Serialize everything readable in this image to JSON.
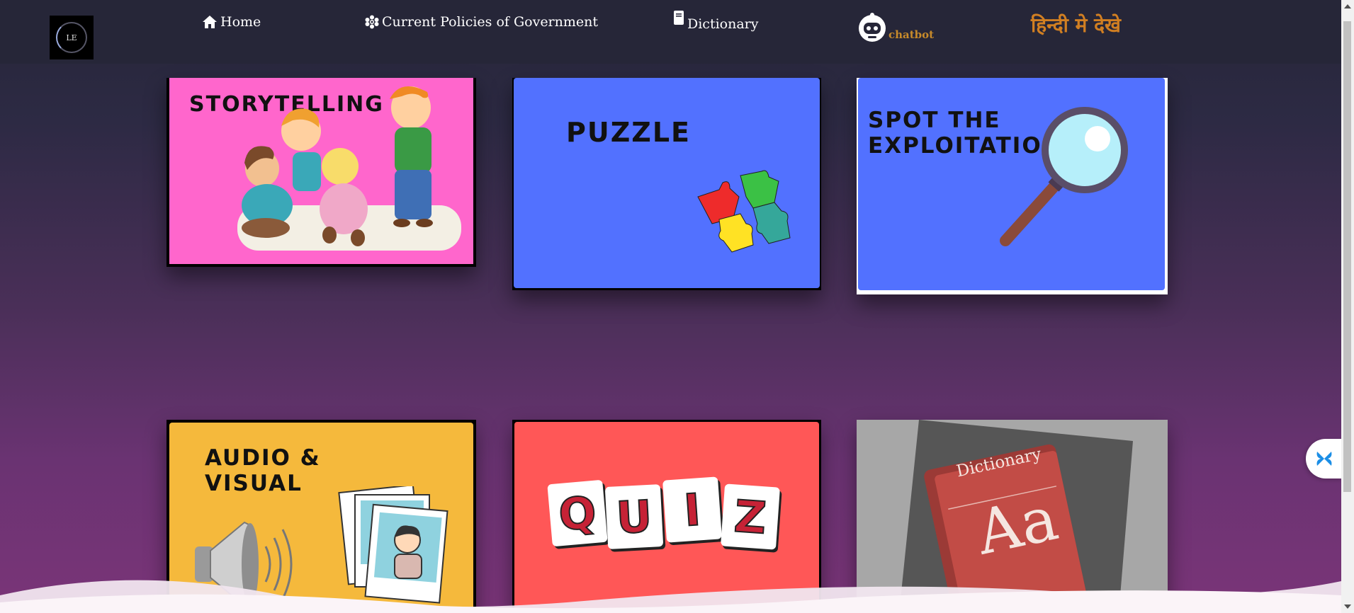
{
  "nav": {
    "home": "Home",
    "policies": "Current Policies of Government",
    "dictionary": "Dictionary",
    "chatbot": "chatbot",
    "hindi": "हिन्दी मे देखे"
  },
  "cards": {
    "storytelling": "STORYTELLING",
    "puzzle": "PUZZLE",
    "spot_line1": "SPOT THE",
    "spot_line2": "EXPLOITATION",
    "audio_line1": "AUDIO &",
    "audio_line2": "VISUAL",
    "quiz_letters": [
      "Q",
      "U",
      "I",
      "Z"
    ],
    "dictionary_book": "Dictionary",
    "dictionary_aa": "Aa"
  },
  "colors": {
    "storytelling_bg": "#ff66cc",
    "puzzle_bg": "#5271ff",
    "audio_bg": "#f5b93c",
    "quiz_bg": "#ff5757",
    "hindi_link": "#d17f22"
  }
}
